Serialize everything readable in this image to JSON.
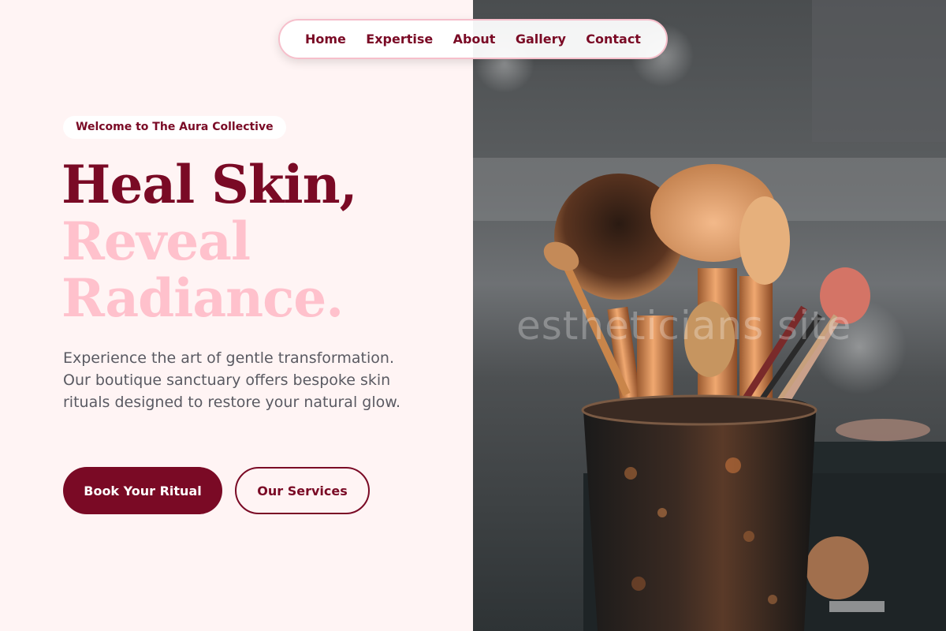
{
  "nav": {
    "items": [
      {
        "label": "Home"
      },
      {
        "label": "Expertise"
      },
      {
        "label": "About"
      },
      {
        "label": "Gallery"
      },
      {
        "label": "Contact"
      }
    ]
  },
  "hero": {
    "badge": "Welcome to The Aura Collective",
    "headline": {
      "line1": "Heal Skin,",
      "line2": "Reveal",
      "line3": "Radiance."
    },
    "description": "Experience the art of gentle transformation. Our boutique sanctuary offers bespoke skin rituals designed to restore your natural glow.",
    "primary_button": "Book Your Ritual",
    "secondary_button": "Our Services"
  },
  "image": {
    "subject": "makeup brushes in a decorative holder",
    "watermark": "estheticians site"
  },
  "colors": {
    "brand": "#7a0a25",
    "accent_pink": "#ffc1cc",
    "background": "#fff4f4",
    "body_text": "#5a5a62"
  }
}
